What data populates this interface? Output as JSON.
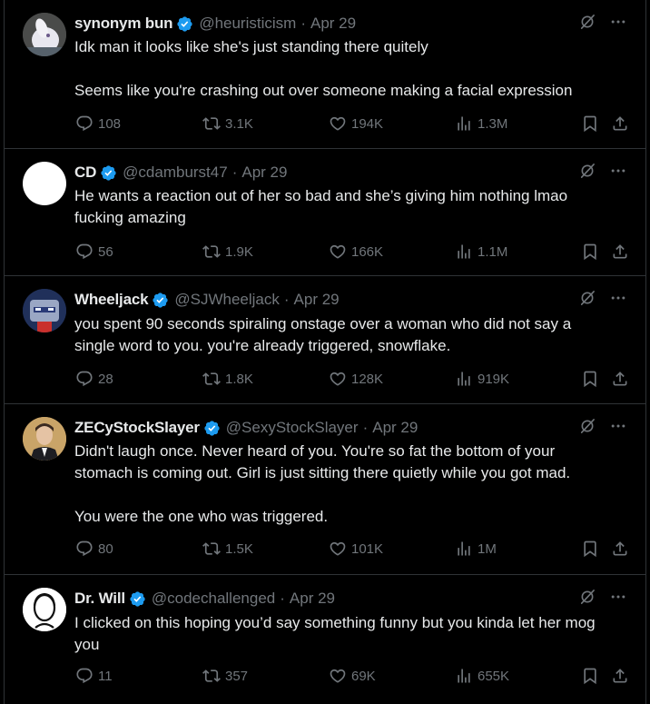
{
  "colors": {
    "background": "#000000",
    "text": "#e7e9ea",
    "muted": "#71767b",
    "verified": "#1d9bf0",
    "divider": "#2f3336"
  },
  "icons": {
    "verified": "verified-badge-icon",
    "grok": "grok-icon",
    "more": "more-icon",
    "reply": "reply-icon",
    "retweet": "retweet-icon",
    "like": "heart-icon",
    "views": "views-icon",
    "bookmark": "bookmark-icon",
    "share": "share-icon"
  },
  "tweets": [
    {
      "name": "synonym bun",
      "handle": "@heuristicism",
      "date": "Apr 29",
      "paragraphs": [
        "Idk man it looks like she's just standing there quitely",
        "Seems like you're crashing out over someone making a facial expression"
      ],
      "replies": "108",
      "retweets": "3.1K",
      "likes": "194K",
      "views": "1.3M"
    },
    {
      "name": "CD",
      "handle": "@cdamburst47",
      "date": "Apr 29",
      "paragraphs": [
        "He wants a reaction out of her so bad and she’s giving him nothing lmao fucking amazing"
      ],
      "replies": "56",
      "retweets": "1.9K",
      "likes": "166K",
      "views": "1.1M"
    },
    {
      "name": "Wheeljack",
      "handle": "@SJWheeljack",
      "date": "Apr 29",
      "paragraphs": [
        "you spent 90 seconds spiraling onstage over a woman who did not say a single word to you. you're already triggered, snowflake."
      ],
      "replies": "28",
      "retweets": "1.8K",
      "likes": "128K",
      "views": "919K"
    },
    {
      "name": "ZECyStockSlayer",
      "handle": "@SexyStockSlayer",
      "date": "Apr 29",
      "paragraphs": [
        "Didn't laugh once. Never heard of you. You're so fat the bottom of your stomach is coming out. Girl is just sitting there quietly while you got mad.",
        "You were the one who was triggered."
      ],
      "replies": "80",
      "retweets": "1.5K",
      "likes": "101K",
      "views": "1M"
    },
    {
      "name": "Dr. Will",
      "handle": "@codechallenged",
      "date": "Apr 29",
      "paragraphs": [
        "I clicked on this hoping you’d say something funny but you kinda let her mog you"
      ],
      "replies": "11",
      "retweets": "357",
      "likes": "69K",
      "views": "655K"
    }
  ]
}
